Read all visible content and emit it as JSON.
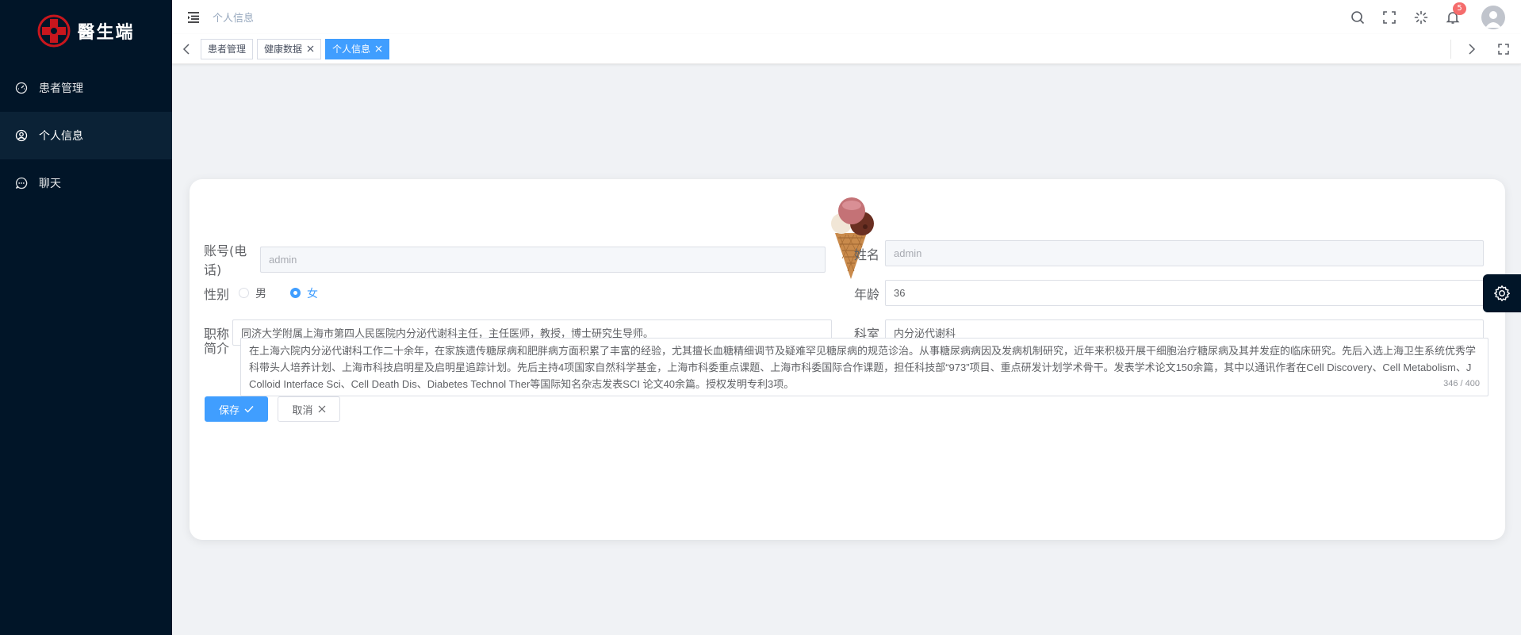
{
  "app": {
    "logo_text": "醫生端",
    "brand_color": "#c8161d"
  },
  "sidebar": {
    "items": [
      {
        "label": "患者管理",
        "icon": "dashboard-icon"
      },
      {
        "label": "个人信息",
        "icon": "user-circle-icon",
        "active": true
      },
      {
        "label": "聊天",
        "icon": "chat-icon"
      }
    ]
  },
  "header": {
    "breadcrumb": "个人信息",
    "notification_count": "5"
  },
  "tags": [
    {
      "label": "患者管理",
      "closable": false
    },
    {
      "label": "健康数据",
      "closable": true
    },
    {
      "label": "个人信息",
      "closable": true,
      "active": true
    }
  ],
  "form": {
    "account_label": "账号(电话)",
    "account_value": "admin",
    "name_label": "姓名",
    "name_value": "admin",
    "gender_label": "性别",
    "gender_options": [
      "男",
      "女"
    ],
    "gender_selected": "女",
    "age_label": "年龄",
    "age_value": "36",
    "title_label": "职称",
    "title_value": "同济大学附属上海市第四人民医院内分泌代谢科主任，主任医师，教授，博士研究生导师。",
    "dept_label": "科室",
    "dept_value": "内分泌代谢科",
    "intro_label": "简介",
    "intro_value": "在上海六院内分泌代谢科工作二十余年，在家族遗传糖尿病和肥胖病方面积累了丰富的经验，尤其擅长血糖精细调节及疑难罕见糖尿病的规范诊治。从事糖尿病病因及发病机制研究，近年来积极开展干细胞治疗糖尿病及其并发症的临床研究。先后入选上海卫生系统优秀学科带头人培养计划、上海市科技启明星及启明星追踪计划。先后主持4项国家自然科学基金，上海市科委重点课题、上海市科委国际合作课题，担任科技部“973”项目、重点研发计划学术骨干。发表学术论文150余篇，其中以通讯作者在Cell Discovery、Cell Metabolism、J Colloid Interface Sci、Cell Death Dis、Diabetes Technol Ther等国际知名杂志发表SCI 论文40余篇。授权发明专利3项。",
    "intro_count": "346 / 400",
    "save_label": "保存",
    "cancel_label": "取消"
  },
  "colors": {
    "sidebar_bg": "#011528",
    "primary": "#409eff",
    "badge": "#f56c6c"
  }
}
